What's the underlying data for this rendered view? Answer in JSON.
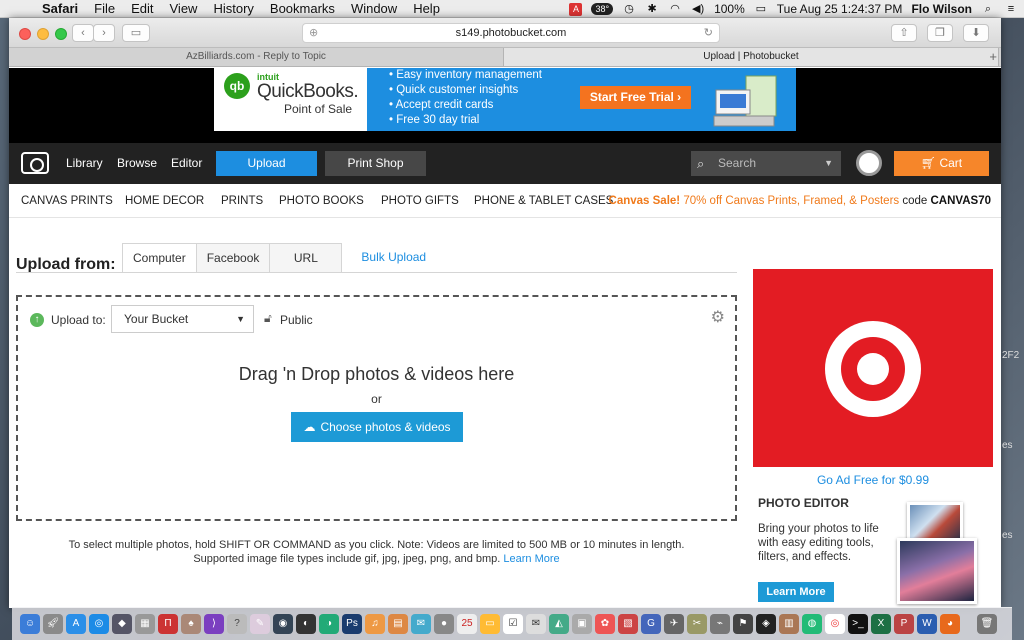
{
  "menubar": {
    "app": "Safari",
    "items": [
      "File",
      "Edit",
      "View",
      "History",
      "Bookmarks",
      "Window",
      "Help"
    ],
    "temperature": "38°",
    "battery": "100%",
    "datetime": "Tue Aug 25  1:24:37 PM",
    "user": "Flo Wilson"
  },
  "browser": {
    "url": "s149.photobucket.com",
    "tabs": [
      {
        "label": "AzBilliards.com - Reply to Topic",
        "active": false
      },
      {
        "label": "Upload | Photobucket",
        "active": true
      }
    ]
  },
  "ad_banner": {
    "brand_intuit": "intuit",
    "brand_name": "QuickBooks.",
    "brand_sub": "Point of Sale",
    "bullets": [
      "Easy inventory management",
      "Quick customer insights",
      "Accept credit cards",
      "Free 30 day trial"
    ],
    "cta": "Start Free Trial ›"
  },
  "nav": {
    "library": "Library",
    "browse": "Browse",
    "editor": "Editor",
    "upload": "Upload",
    "print_shop": "Print Shop",
    "search_placeholder": "Search",
    "cart": "Cart"
  },
  "subnav": {
    "items": [
      "CANVAS PRINTS",
      "HOME DECOR",
      "PRINTS",
      "PHOTO BOOKS",
      "PHOTO GIFTS",
      "PHONE & TABLET CASES"
    ],
    "promo_bold": "Canvas Sale!",
    "promo_text": " 70% off Canvas Prints, Framed, & Posters ",
    "promo_code_label": "code ",
    "promo_code": "CANVAS70"
  },
  "upload": {
    "title": "Upload from:",
    "tabs": [
      "Computer",
      "Facebook",
      "URL"
    ],
    "bulk": "Bulk Upload",
    "upload_to_label": "Upload to:",
    "bucket": "Your Bucket",
    "privacy": "Public",
    "drop_title": "Drag 'n Drop photos & videos here",
    "or": "or",
    "choose_button": "Choose photos & videos",
    "note_line1": "To select multiple photos, hold SHIFT OR COMMAND as you click. Note: Videos are limited to 500 MB or 10 minutes in length.",
    "note_line2": "Supported image file types include gif, jpg, jpeg, png, and bmp. ",
    "learn_more": "Learn More"
  },
  "sidebar": {
    "ad_free": "Go Ad Free for $0.99",
    "photo_editor_title": "PHOTO EDITOR",
    "photo_editor_desc": "Bring your photos to life with easy editing tools, filters, and effects.",
    "learn_more": "Learn More"
  },
  "desktop": {
    "edge_text_1": "2F2",
    "edge_text_2": "es",
    "edge_text_3": "es"
  },
  "colors": {
    "accent_blue": "#1d8ee0",
    "cart_orange": "#f6862a",
    "target_red": "#e31c23"
  }
}
